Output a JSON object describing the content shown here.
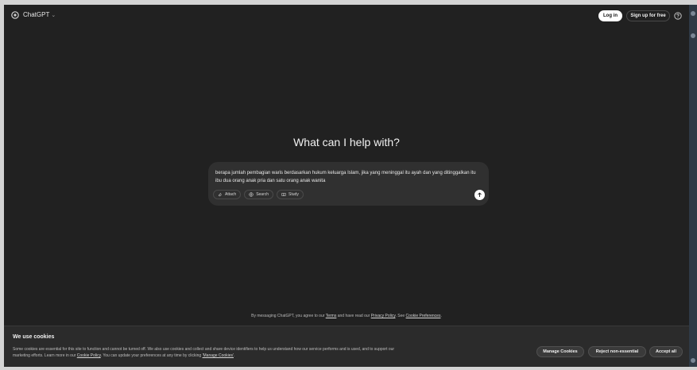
{
  "header": {
    "brand": "ChatGPT",
    "brand_chevron": "⌄",
    "login_label": "Log in",
    "signup_label": "Sign up for free",
    "help_icon": "question-circle-icon"
  },
  "main": {
    "headline": "What can I help with?",
    "prompt_text": "berapa jumlah pembagian waris berdasarkan hukum keluarga Islam, jika yang meninggal itu ayah dan yang ditinggalkan itu ibu dua orang anak pria dan satu orang anak wanita",
    "tools": [
      {
        "label": "Attach",
        "icon": "paperclip-icon"
      },
      {
        "label": "Search",
        "icon": "globe-icon"
      },
      {
        "label": "Study",
        "icon": "book-icon"
      }
    ],
    "send_icon": "arrow-up-icon"
  },
  "legal": {
    "prefix": "By messaging ChatGPT, you agree to our ",
    "terms": "Terms",
    "middle": " and have read our ",
    "privacy": "Privacy Policy",
    "sep": ". See ",
    "cookie_prefs": "Cookie Preferences",
    "suffix": "."
  },
  "cookies": {
    "title": "We use cookies",
    "text_1": "Some cookies are essential for this site to function and cannot be turned off. We also use cookies and collect and share device identifiers to help us understand how our service performs and is used, and to support our marketing efforts. Learn more in our ",
    "cookie_policy": "Cookie Policy",
    "text_2": ". You can update your preferences at any time by clicking ",
    "manage_link": "'Manage Cookies'",
    "text_3": ".",
    "buttons": {
      "manage": "Manage Cookies",
      "reject": "Reject non-essential",
      "accept": "Accept all"
    }
  },
  "colors": {
    "background": "#212121",
    "composer": "#303030",
    "banner": "#2b2b2b"
  }
}
